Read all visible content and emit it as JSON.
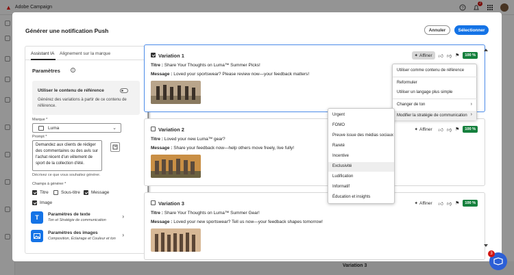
{
  "app": {
    "title": "Adobe Campaign",
    "notification_count": "2"
  },
  "background": {
    "variation3_label": "Variation 3",
    "help_badge": "3"
  },
  "dialog": {
    "title": "Générer une notification Push",
    "cancel_label": "Annuler",
    "select_label": "Sélectionner"
  },
  "tabs": [
    {
      "label": "Assistant IA",
      "active": true
    },
    {
      "label": "Alignement sur la marque",
      "active": false
    }
  ],
  "params": {
    "title": "Paramètres",
    "reference": {
      "title": "Utiliser le contenu de référence",
      "desc": "Générez des variations à partir de ce contenu de référence.",
      "enabled": false
    },
    "brand_label": "Marque",
    "brand_value": "Luma",
    "prompt_label": "Prompt",
    "prompt_value": "Demandez aux clients de rédiger des commentaires ou des avis sur l'achat récent d'un vêtement de sport de la collection d'été.",
    "prompt_hint": "Décrivez ce que vous souhaitez générer.",
    "fields_label": "Champs à générer",
    "fields": [
      {
        "label": "Titre",
        "checked": true
      },
      {
        "label": "Sous-titre",
        "checked": false
      },
      {
        "label": "Message",
        "checked": true
      },
      {
        "label": "Image",
        "checked": true
      }
    ],
    "categories": [
      {
        "title": "Paramètres de texte",
        "sub": "Ton et Stratégie de communication"
      },
      {
        "title": "Paramètres des images",
        "sub": "Composition, Éclairage et Couleur et ton"
      }
    ]
  },
  "variations": [
    {
      "name": "Variation 1",
      "checked": true,
      "title_label": "Titre :",
      "title": "Share Your Thoughts on Luma™ Summer Picks!",
      "message_label": "Message :",
      "message": "Loved your sportswear? Please review now—your feedback matters!",
      "refine": "Affiner",
      "score": "100 %"
    },
    {
      "name": "Variation 2",
      "checked": false,
      "title_label": "Titre :",
      "title": "Loved your new Luma™ gear?",
      "message_label": "Message :",
      "message": "Share your feedback now—help others move freely, live fully!",
      "refine": "Affiner",
      "score": "100 %"
    },
    {
      "name": "Variation 3",
      "checked": false,
      "title_label": "Titre :",
      "title": "Share Your Thoughts on Luma™ Summer Gear!",
      "message_label": "Message :",
      "message": "Loved your new sportswear? Tell us now—your feedback shapes tomorrow!",
      "refine": "Affiner",
      "score": "100 %"
    }
  ],
  "refine_menu": {
    "items": [
      {
        "label": "Utiliser comme contenu de référence"
      },
      {
        "label": "Reformuler"
      },
      {
        "label": "Utiliser un langage plus simple"
      },
      {
        "label": "Changer de ton"
      },
      {
        "label": "Modifier la stratégie de communication"
      }
    ]
  },
  "strategy_menu": {
    "items": [
      "Urgent",
      "FOMO",
      "Preuve issue des médias sociaux",
      "Rareté",
      "Incentive",
      "Exclusivité",
      "Ludification",
      "Informatif",
      "Éducation et insights"
    ]
  },
  "colors": {
    "accent": "#1473e6",
    "score": "#15803d",
    "brand_logo": "#eb1000"
  }
}
